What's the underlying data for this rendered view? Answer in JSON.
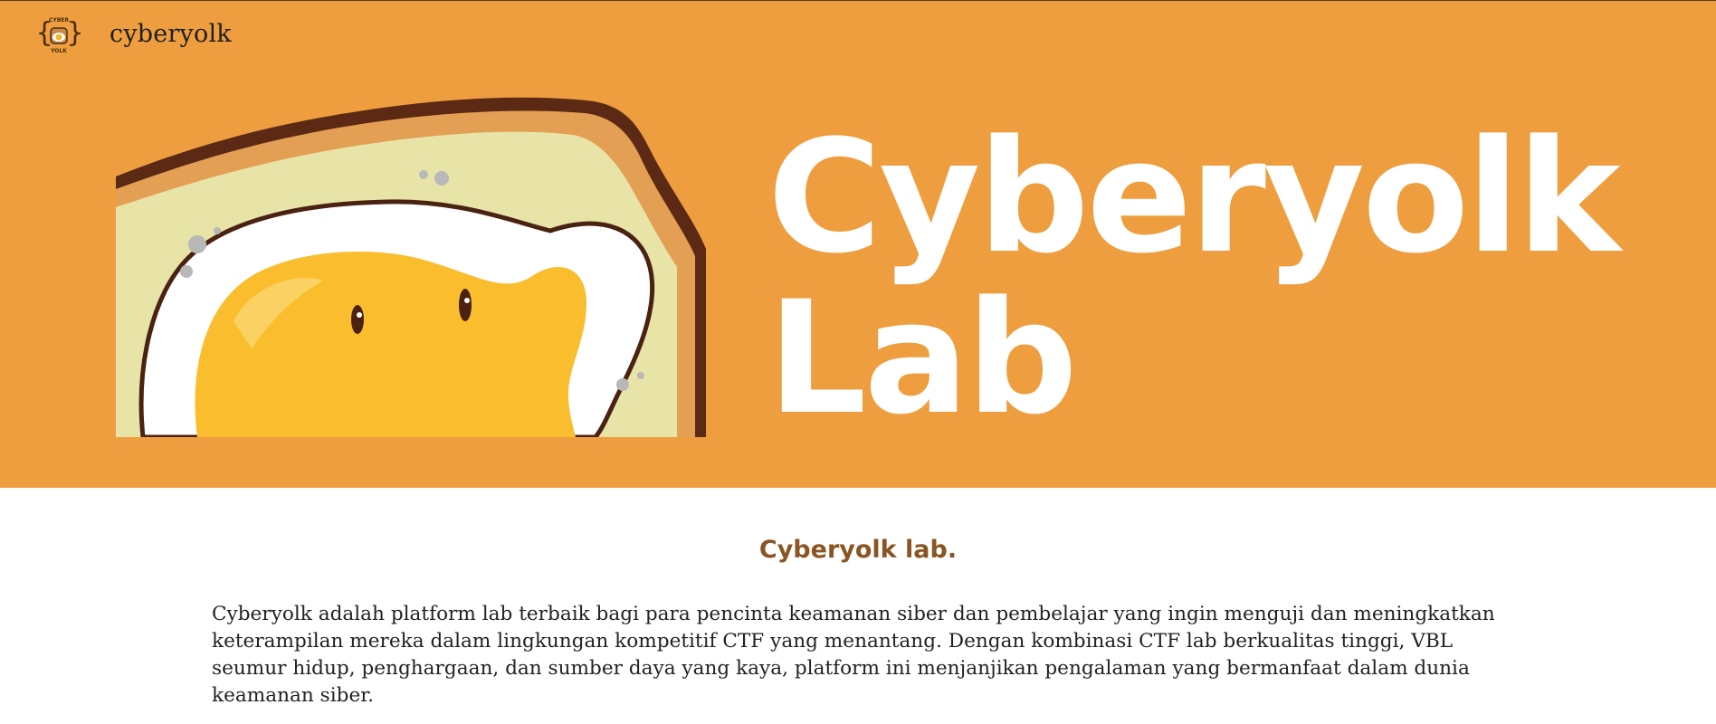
{
  "navbar": {
    "brand": "cyberyolk",
    "logo_top_text": "CYBER",
    "logo_bottom_text": "YOLK"
  },
  "hero": {
    "title_line1": "Cyberyolk",
    "title_line2": "Lab",
    "background_color": "#EE9E3E",
    "illustration": "egg-on-toast-icon"
  },
  "section": {
    "heading": "Cyberyolk lab.",
    "heading_color": "#8A5523",
    "description": "Cyberyolk adalah platform lab terbaik bagi para pencinta keamanan siber dan pembelajar yang ingin menguji dan meningkatkan keterampilan mereka dalam lingkungan kompetitif CTF yang menantang. Dengan kombinasi CTF lab berkualitas tinggi, VBL seumur hidup, penghargaan, dan sumber daya yang kaya, platform ini menjanjikan pengalaman yang bermanfaat dalam dunia keamanan siber."
  }
}
